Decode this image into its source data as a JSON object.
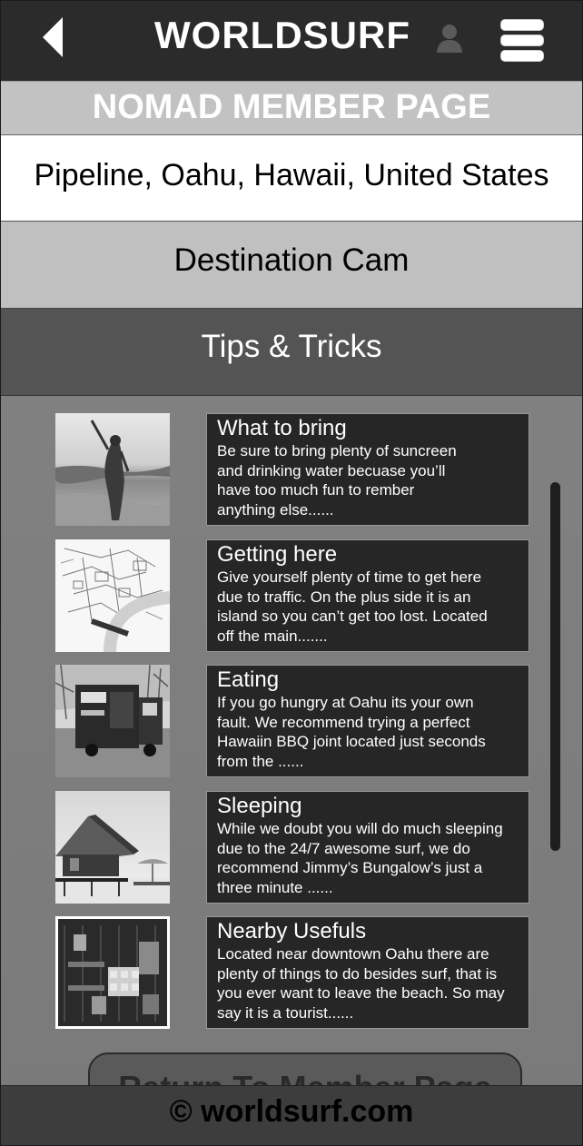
{
  "header": {
    "title": "WORLDSURF",
    "back_icon": "chevron-left-icon",
    "user_icon": "user-icon",
    "menu_icon": "hamburger-menu-icon"
  },
  "page_title": "NOMAD MEMBER PAGE",
  "location": "Pipeline, Oahu, Hawaii, United States",
  "tabs": {
    "cam": "Destination Cam",
    "tips": "Tips & Tricks"
  },
  "tips": [
    {
      "title": "What to bring",
      "lines": [
        "Be sure to bring plenty of suncreen",
        "and drinking water becuase you’ll",
        "have too much fun to rember",
        "anything else......"
      ],
      "image": "photo-woman-at-beach"
    },
    {
      "title": "Getting here",
      "lines": [
        "Give yourself plenty of time to get here",
        "due to traffic. On the plus side it is an",
        "island so you can’t get too lost. Located",
        "off the main......."
      ],
      "image": "map-of-area"
    },
    {
      "title": "Eating",
      "lines": [
        "If you go hungry at Oahu its your own",
        "fault. We recommend trying a perfect",
        "Hawaiin BBQ joint located just seconds",
        "from the ......"
      ],
      "image": "photo-food-truck"
    },
    {
      "title": "Sleeping",
      "lines": [
        "While we doubt you will do much sleeping",
        "due to the 24/7 awesome surf, we do",
        "recommend Jimmy’s Bungalow’s just a",
        "three minute ......"
      ],
      "image": "photo-beach-bungalow"
    },
    {
      "title": "Nearby Usefuls",
      "lines": [
        "Located near downtown Oahu there are",
        "plenty of things to do besides surf, that is",
        "you ever want to leave the beach. So may",
        "say it is a tourist......"
      ],
      "image": "photo-shop-shelves"
    }
  ],
  "return_button": "Return To Member Page",
  "footer": "© worldsurf.com",
  "colors": {
    "header_bg": "#2b2b2b",
    "card_bg": "#262626",
    "active_tab": "#545454",
    "inactive_tab": "#c0c0c0"
  }
}
